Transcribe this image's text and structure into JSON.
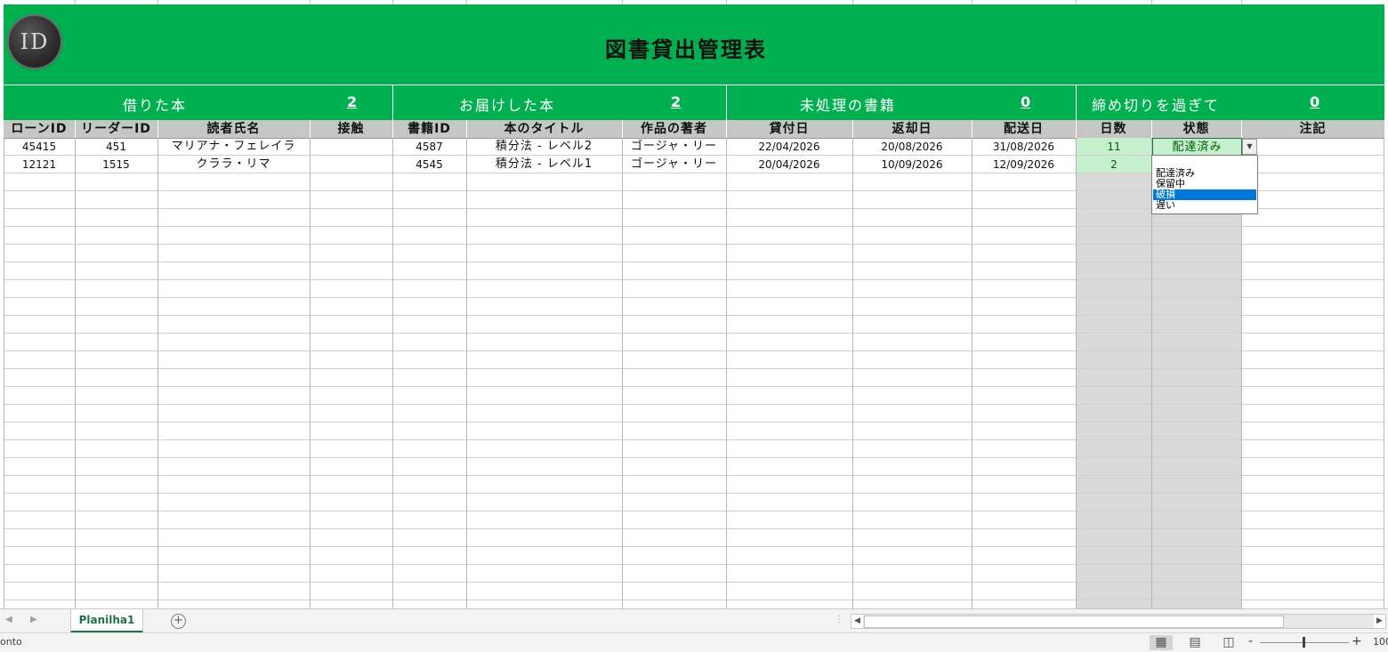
{
  "sheet": {
    "title": "図書貸出管理表",
    "logo_text": "ID",
    "summary": [
      {
        "label": "借りた本",
        "value": "2"
      },
      {
        "label": "お届けした本",
        "value": "2"
      },
      {
        "label": "未処理の書籍",
        "value": "0"
      },
      {
        "label": "締め切りを過ぎて",
        "value": "0"
      }
    ],
    "columns": [
      "ローンID",
      "リーダーID",
      "読者氏名",
      "接触",
      "書籍ID",
      "本のタイトル",
      "作品の著者",
      "貸付日",
      "返却日",
      "配送日",
      "日数",
      "状態",
      "注記"
    ],
    "rows": [
      {
        "loan_id": "45415",
        "reader_id": "451",
        "reader_name": "マリアナ・フェレイラ",
        "contact": "",
        "book_id": "4587",
        "book_title": "積分法 - レベル2",
        "author": "ゴージャ・リー",
        "loan_date": "22/04/2026",
        "return_date": "20/08/2026",
        "delivery_date": "31/08/2026",
        "days": "11",
        "status": "配達済み",
        "note": ""
      },
      {
        "loan_id": "12121",
        "reader_id": "1515",
        "reader_name": "クララ・リマ",
        "contact": "",
        "book_id": "4545",
        "book_title": "積分法 - レベル1",
        "author": "ゴージャ・リー",
        "loan_date": "20/04/2026",
        "return_date": "10/09/2026",
        "delivery_date": "12/09/2026",
        "days": "2",
        "status": "",
        "note": ""
      }
    ],
    "status_dropdown": {
      "options": [
        "配達済み",
        "保留中",
        "破損",
        "遅い"
      ],
      "highlighted": "破損",
      "arrow_icon": "chevron-down-icon"
    }
  },
  "tabs": {
    "sheets": [
      "Planilha1"
    ],
    "active": "Planilha1",
    "add_icon": "plus-circle-icon"
  },
  "statusbar": {
    "status_text": "onto",
    "zoom_minus": "-",
    "zoom_plus": "+",
    "zoom_level": "100",
    "view_icons": [
      "normal-view-icon",
      "page-layout-view-icon",
      "page-break-view-icon"
    ]
  },
  "colors": {
    "banner_green": "#00b050",
    "header_gray": "#c6c6c6",
    "days_fill": "#c6efce",
    "days_text": "#006100",
    "accent": "#217346",
    "selection_blue": "#0078d7"
  }
}
